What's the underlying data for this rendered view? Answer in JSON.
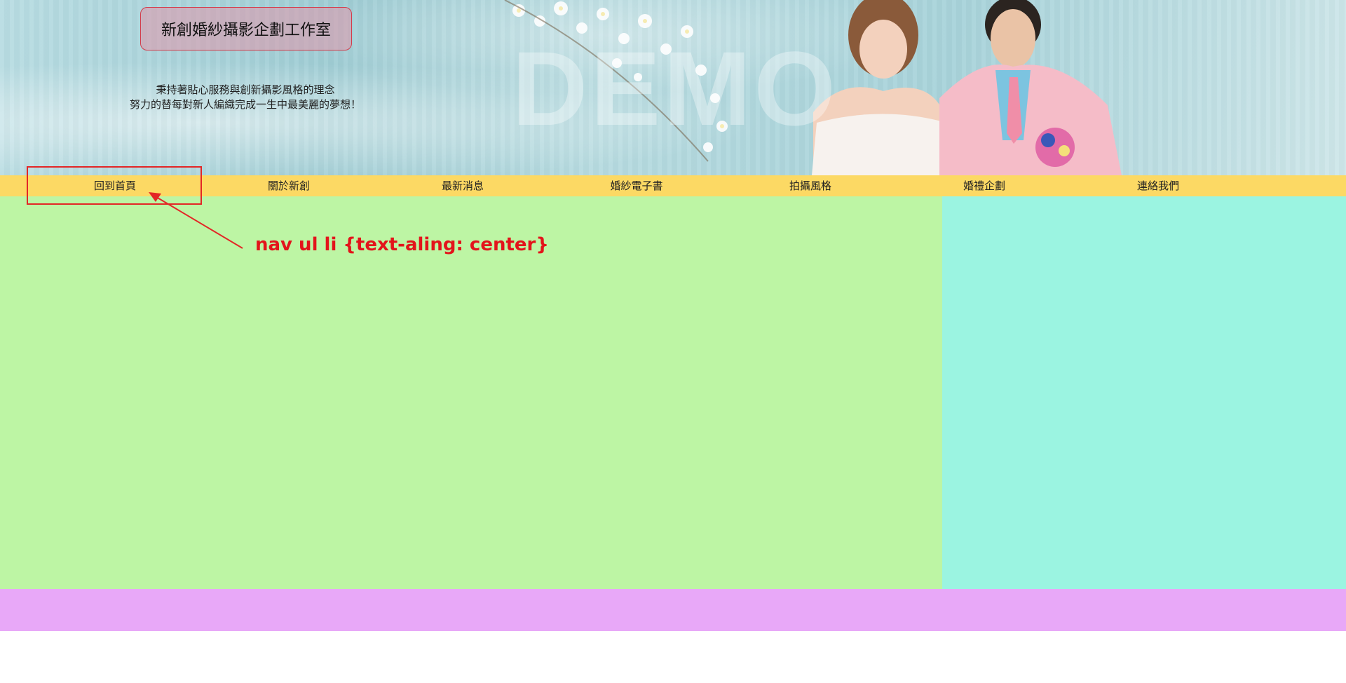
{
  "header": {
    "logo_text": "新創婚紗攝影企劃工作室",
    "tagline_line1": "秉持著貼心服務與創新攝影風格的理念",
    "tagline_line2": "努力的替每對新人編織完成一生中最美麗的夢想！",
    "watermark": "DEMO"
  },
  "nav": {
    "items": [
      {
        "label": "回到首頁"
      },
      {
        "label": "關於新創"
      },
      {
        "label": "最新消息"
      },
      {
        "label": "婚紗電子書"
      },
      {
        "label": "拍攝風格"
      },
      {
        "label": "婚禮企劃"
      },
      {
        "label": "連絡我們"
      }
    ]
  },
  "annotation": {
    "text": "nav ul li {text-aling: center}"
  },
  "colors": {
    "nav_bg": "#fcd964",
    "main_bg": "#bdf5a4",
    "aside_bg": "#9bf4e1",
    "footer_bg": "#e8a8f8",
    "annotation": "#e3141b"
  }
}
